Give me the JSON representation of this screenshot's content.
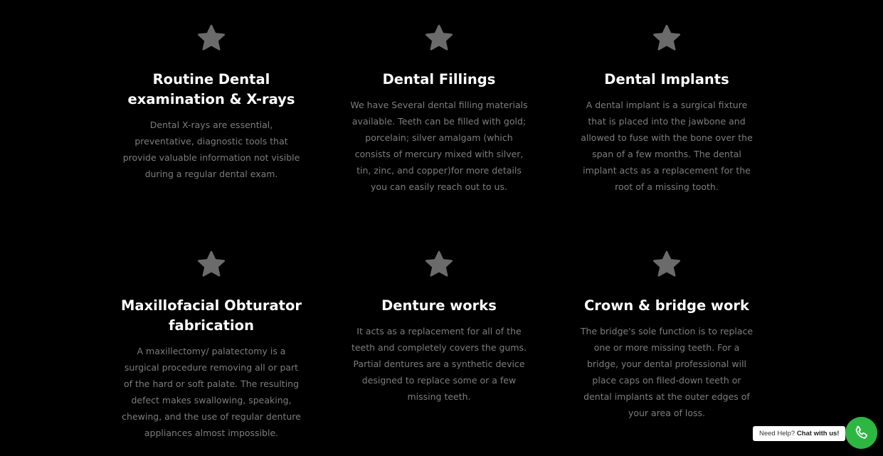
{
  "services": [
    {
      "icon": "star-icon",
      "title": "Routine Dental examination & X-rays",
      "description": "Dental X-rays are essential, preventative, diagnostic tools that provide valuable information not visible during a regular dental exam."
    },
    {
      "icon": "star-icon",
      "title": "Dental Fillings",
      "description": "We have Several dental filling materials available. Teeth can be filled with gold; porcelain; silver amalgam (which consists of mercury mixed with silver, tin, zinc, and copper)for more details you can easily reach out to us."
    },
    {
      "icon": "star-icon",
      "title": "Dental Implants",
      "description": "A dental implant is a surgical fixture that is placed into the jawbone and allowed to fuse with the bone over the span of a few months. The dental implant acts as a replacement for the root of a missing tooth."
    },
    {
      "icon": "star-icon",
      "title": "Maxillofacial Obturator fabrication",
      "description": "A maxillectomy/ palatectomy is a surgical procedure removing all or part of the hard or soft palate. The resulting defect makes swallowing, speaking, chewing, and the use of regular denture appliances almost impossible."
    },
    {
      "icon": "star-icon",
      "title": "Denture works",
      "description": "It acts as a replacement for all of the teeth and completely covers the gums. Partial dentures are a synthetic device designed to replace some or a few missing teeth."
    },
    {
      "icon": "star-icon",
      "title": "Crown & bridge work",
      "description": "The bridge's sole function is to replace one or more missing teeth. For a bridge, your dental professional will place caps on filed-down teeth or dental implants at the outer edges of your area of loss."
    }
  ],
  "chat_widget": {
    "prompt": "Need Help?",
    "action": "Chat with us!",
    "icon": "phone-icon"
  },
  "colors": {
    "background": "#000000",
    "title": "#ffffff",
    "description": "#7d7d7d",
    "star": "#6b6b6b",
    "chat_button": "#2db742"
  }
}
